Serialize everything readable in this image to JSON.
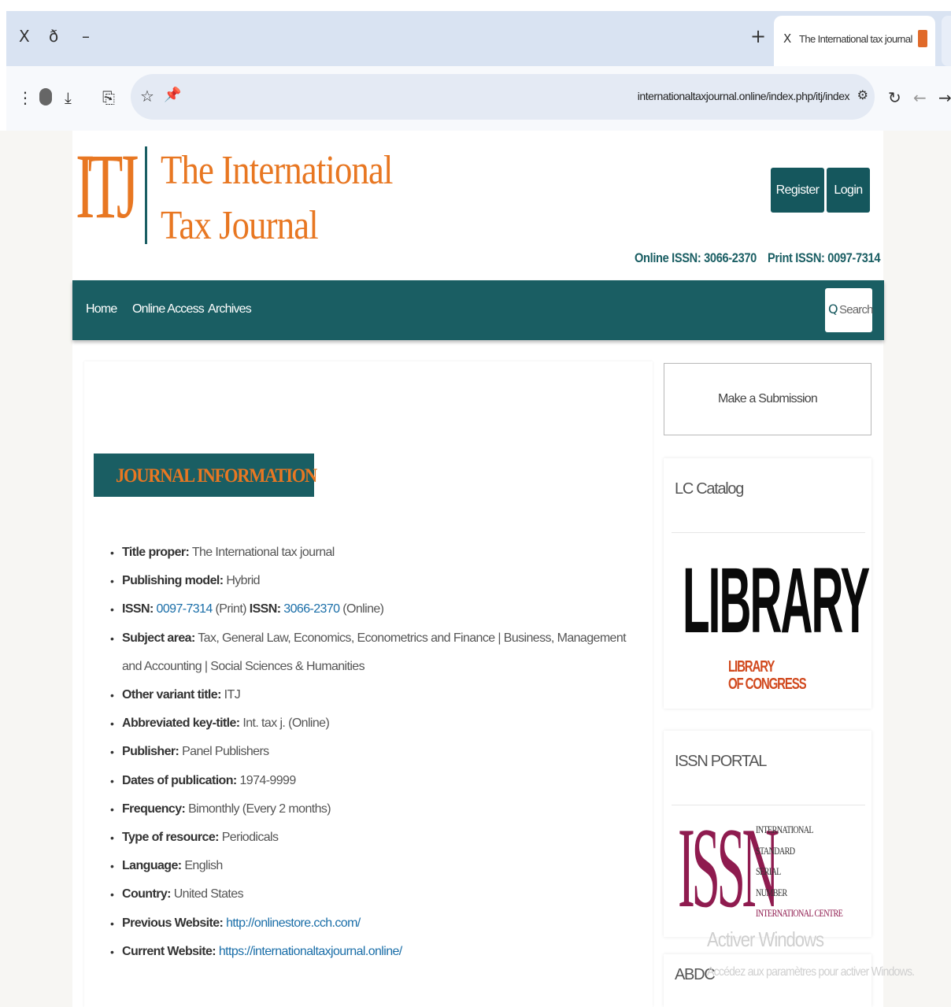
{
  "browser": {
    "window_controls": {
      "close": "X",
      "save": "ð",
      "minimize": "–"
    },
    "new_tab": "+",
    "tab": {
      "close": "X",
      "title": "The International tax journal"
    },
    "tab_menu": "⌄",
    "toolbar": {
      "menu": "⋮",
      "download": "⤓",
      "copy": "⎘",
      "star": "☆",
      "pin": "📌",
      "tune": "⚙",
      "reload": "↻",
      "back": "←",
      "forward": "→"
    },
    "url": "internationaltaxjournal.online/index.php/itj/index"
  },
  "site": {
    "logo": {
      "initials": "ITJ",
      "line1": "The International",
      "line2": "Tax Journal"
    },
    "register_label": "Register",
    "login_label": "Login",
    "online_issn": "Online ISSN: 3066-2370",
    "print_issn": "Print ISSN: 0097-7314",
    "nav": [
      {
        "label": "Home"
      },
      {
        "label": "Online Access"
      },
      {
        "label": "Archives"
      }
    ],
    "search_label": "Search",
    "search_icon": "Q",
    "banner": "JOURNAL INFORMATION",
    "info": {
      "title_lbl": "Title proper:",
      "title_val": "The International tax journal",
      "model_lbl": "Publishing model:",
      "model_val": "Hybrid",
      "issn_lbl1": "ISSN:",
      "issn_print": "0097-7314",
      "issn_print_suffix": "(Print)",
      "issn_lbl2": "ISSN:",
      "issn_online": "3066-2370",
      "issn_online_suffix": "(Online)",
      "subject_lbl": "Subject area:",
      "subject_val": "Tax, General Law, Economics, Econometrics and Finance | Business, Management and Accounting | Social Sciences & Humanities",
      "variant_lbl": "Other variant title:",
      "variant_val": "ITJ",
      "abbr_lbl": "Abbreviated key-title:",
      "abbr_val": "Int. tax j. (Online)",
      "publisher_lbl": "Publisher:",
      "publisher_val": "Panel Publishers",
      "dates_lbl": "Dates of publication:",
      "dates_val": "1974-9999",
      "freq_lbl": "Frequency:",
      "freq_val": "Bimonthly (Every 2 months)",
      "type_lbl": "Type of resource:",
      "type_val": "Periodicals",
      "lang_lbl": "Language:",
      "lang_val": "English",
      "country_lbl": "Country:",
      "country_val": "United States",
      "prev_lbl": "Previous Website:",
      "prev_val": "http://onlinestore.cch.com/",
      "curr_lbl": "Current Website:",
      "curr_val": "https://internationaltaxjournal.online/"
    }
  },
  "sidebar": {
    "submit_label": "Make a Submission",
    "lc_title": "LC Catalog",
    "library_word": "LIBRARY",
    "library_sub1": "LIBRARY",
    "library_sub2": "OF CONGRESS",
    "issn_title": "ISSN PORTAL",
    "issn_big": "ISSN",
    "issn_words": [
      "INTERNATIONAL",
      "STANDARD",
      "SERIAL",
      "NUMBER",
      "INTERNATIONAL CENTRE"
    ],
    "abdc_title": "ABDC"
  },
  "watermark": {
    "line1": "Activer Windows",
    "line2": "Accédez aux paramètres pour activer Windows."
  },
  "colors": {
    "teal": "#1a5e63",
    "orange": "#e87722",
    "issn_maroon": "#8f1b4f",
    "link_blue": "#1a6ea8"
  }
}
